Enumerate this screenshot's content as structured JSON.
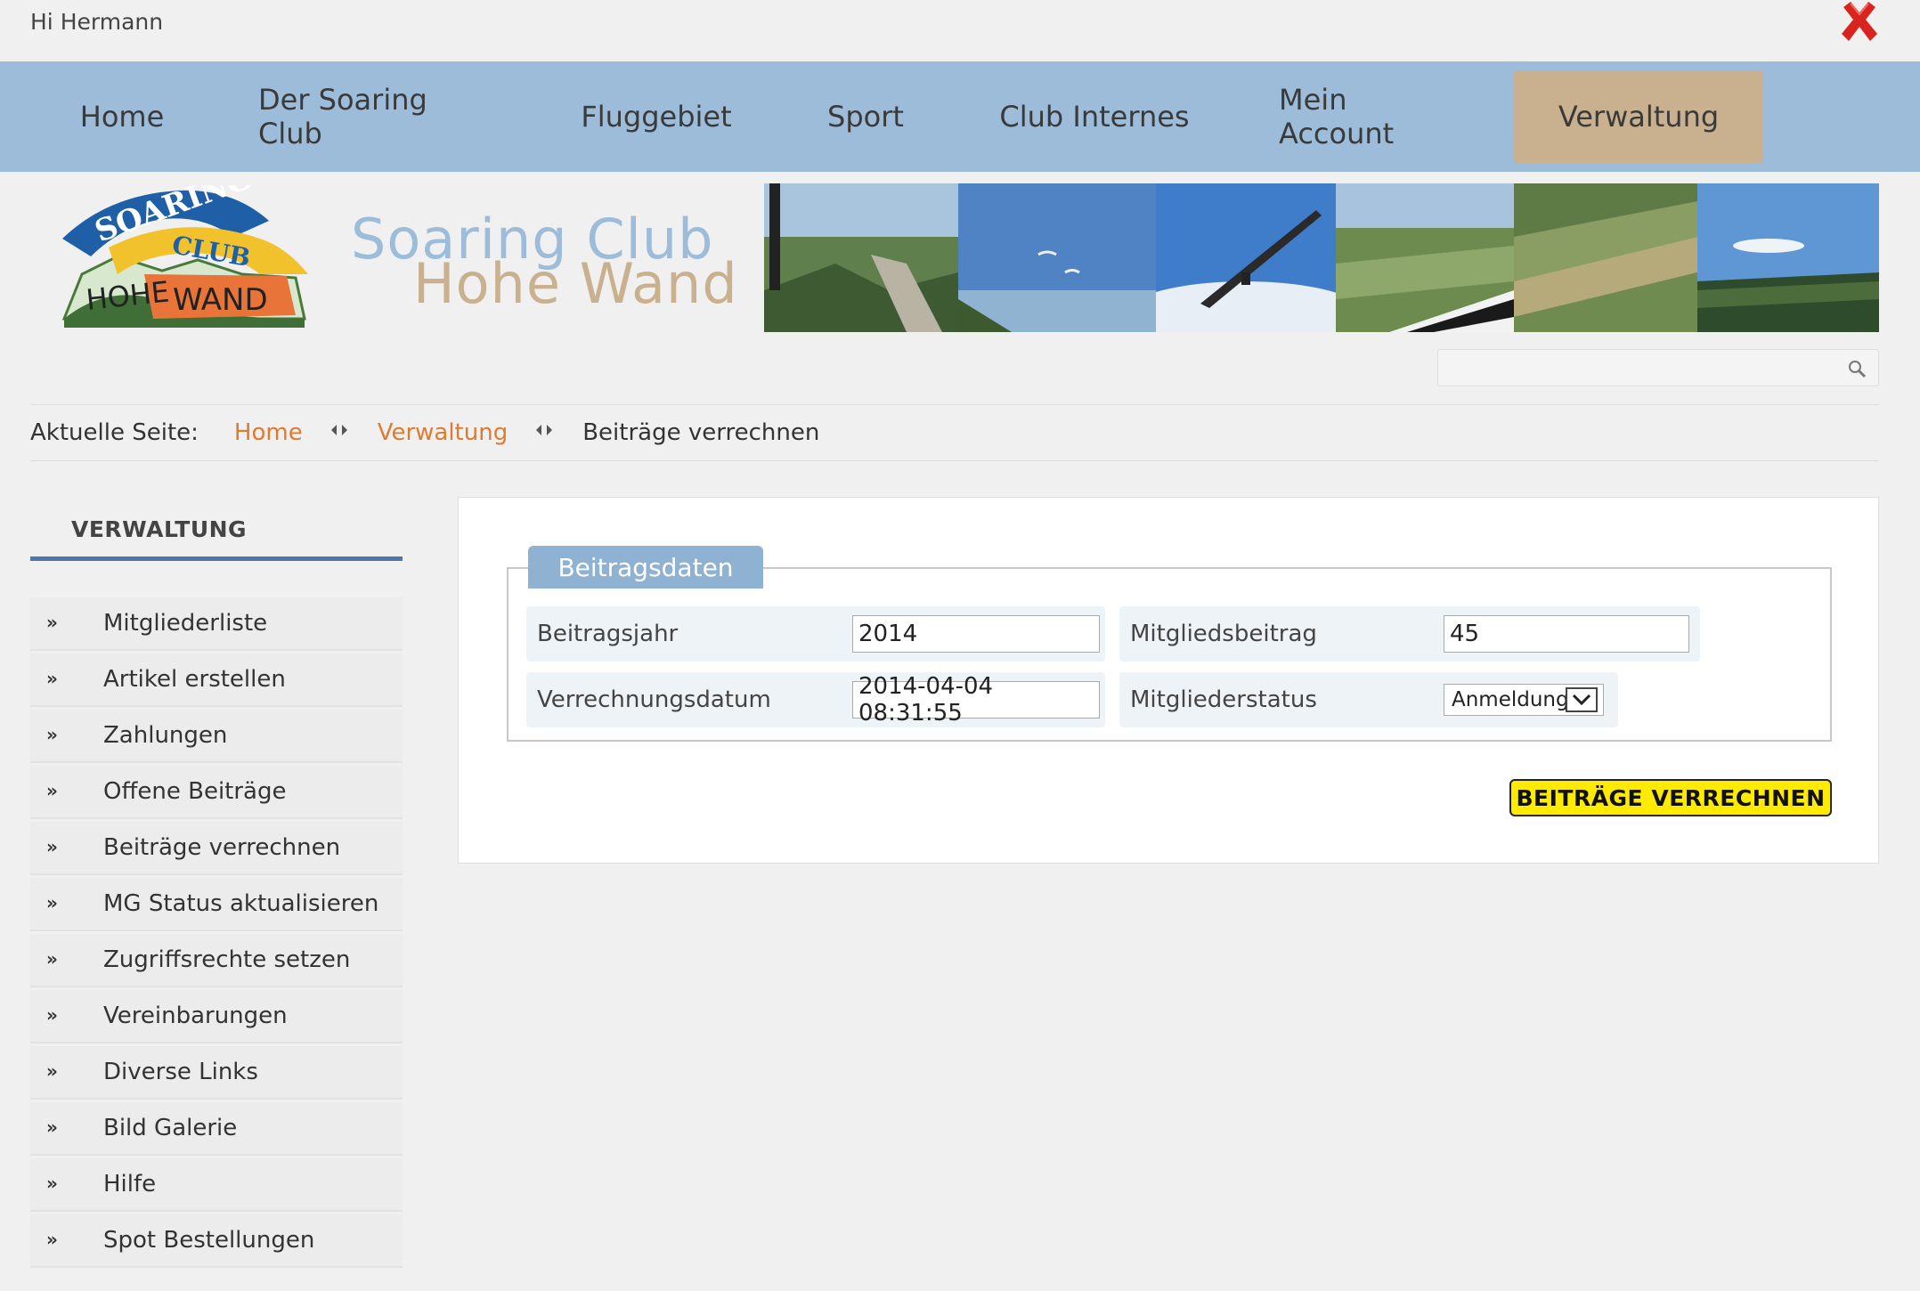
{
  "topbar": {
    "greeting": "Hi Hermann"
  },
  "nav": {
    "items": [
      {
        "label": "Home"
      },
      {
        "label": "Der Soaring Club"
      },
      {
        "label": "Fluggebiet"
      },
      {
        "label": "Sport"
      },
      {
        "label": "Club Internes"
      },
      {
        "label": "Mein Account"
      },
      {
        "label": "Verwaltung"
      }
    ],
    "active": "Verwaltung"
  },
  "header": {
    "brand_line1": "Soaring  Club",
    "brand_line2": "Hohe  Wand",
    "logo_text_top": "SOARING",
    "logo_text_mid": "CLUB",
    "logo_text_bottom_left": "HOHE",
    "logo_text_bottom_right": "WAND"
  },
  "search": {
    "placeholder": ""
  },
  "breadcrumb": {
    "label": "Aktuelle Seite:",
    "links": [
      "Home",
      "Verwaltung"
    ],
    "current": "Beiträge verrechnen"
  },
  "sidebar": {
    "title": "VERWALTUNG",
    "items": [
      {
        "label": "Mitgliederliste"
      },
      {
        "label": "Artikel erstellen"
      },
      {
        "label": "Zahlungen"
      },
      {
        "label": "Offene Beiträge"
      },
      {
        "label": "Beiträge verrechnen"
      },
      {
        "label": "MG Status aktualisieren"
      },
      {
        "label": "Zugriffsrechte setzen"
      },
      {
        "label": "Vereinbarungen"
      },
      {
        "label": "Diverse Links"
      },
      {
        "label": "Bild Galerie"
      },
      {
        "label": "Hilfe"
      },
      {
        "label": "Spot Bestellungen"
      }
    ]
  },
  "form": {
    "legend": "Beitragsdaten",
    "fields": {
      "beitragsjahr": {
        "label": "Beitragsjahr",
        "value": "2014"
      },
      "mitgliedsbeitrag": {
        "label": "Mitgliedsbeitrag",
        "value": "45"
      },
      "verrechnungsdatum": {
        "label": "Verrechnungsdatum",
        "value": "2014-04-04 08:31:55"
      },
      "mitgliederstatus": {
        "label": "Mitgliederstatus",
        "value": "Anmeldung"
      }
    },
    "submit_label": "BEITRÄGE VERRECHNEN"
  },
  "colors": {
    "nav_bg": "#9cbcd9",
    "nav_active": "#c9b08f",
    "link_orange": "#e07a2e",
    "accent_blue": "#4d77a8",
    "button_yellow": "#ffeb00"
  }
}
